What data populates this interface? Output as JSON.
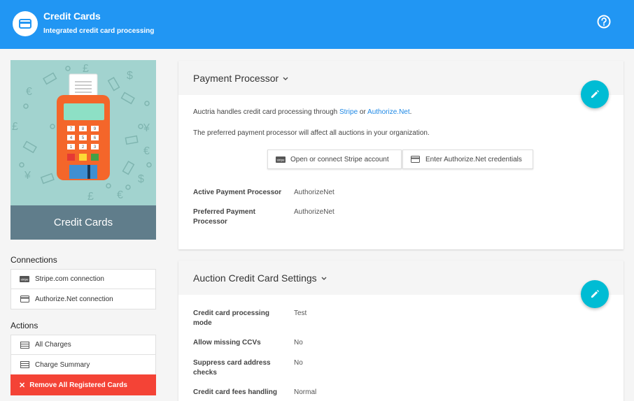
{
  "header": {
    "title": "Credit Cards",
    "subtitle": "Integrated credit card processing",
    "app_icon": "credit-card-icon",
    "help_icon": "help-circle-icon",
    "color": "#2196f3"
  },
  "sidebar": {
    "hero_label": "Credit Cards",
    "connections_title": "Connections",
    "connections": [
      {
        "label": "Stripe.com connection",
        "icon": "stripe-icon"
      },
      {
        "label": "Authorize.Net connection",
        "icon": "credit-card-icon"
      }
    ],
    "actions_title": "Actions",
    "actions": [
      {
        "label": "All Charges",
        "icon": "list-icon"
      },
      {
        "label": "Charge Summary",
        "icon": "list-icon"
      }
    ],
    "danger_action": "Remove All Registered Cards",
    "danger_color": "#f44336"
  },
  "payment_processor": {
    "title": "Payment Processor",
    "desc_prefix": "Auctria handles credit card processing through ",
    "link_stripe": "Stripe",
    "desc_or": " or ",
    "link_authorize": "Authorize.Net",
    "desc_suffix": ".",
    "desc2": "The preferred payment processor will affect all auctions in your organization.",
    "btn_stripe": "Open or connect Stripe account",
    "btn_authorize": "Enter Authorize.Net credentials",
    "rows": [
      {
        "label": "Active Payment Processor",
        "value": "AuthorizeNet"
      },
      {
        "label": "Preferred Payment Processor",
        "value": "AuthorizeNet"
      }
    ]
  },
  "auction_settings": {
    "title": "Auction Credit Card Settings",
    "rows": [
      {
        "label": "Credit card processing mode",
        "value": "Test"
      },
      {
        "label": "Allow missing CCVs",
        "value": "No"
      },
      {
        "label": "Suppress card address checks",
        "value": "No"
      },
      {
        "label": "Credit card fees handling",
        "value": "Normal"
      }
    ]
  },
  "colors": {
    "accent": "#00bcd4",
    "link": "#1e88e5",
    "hero_bg": "#a2d3cf",
    "hero_label_bg": "#607d8b"
  }
}
